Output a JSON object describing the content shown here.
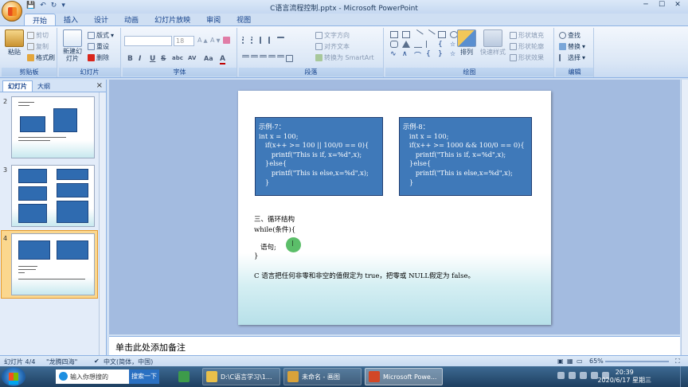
{
  "window": {
    "title": "C语言流程控制.pptx - Microsoft PowerPoint"
  },
  "ribbon": {
    "tabs": [
      "开始",
      "插入",
      "设计",
      "动画",
      "幻灯片放映",
      "审阅",
      "视图"
    ],
    "active_tab": "开始",
    "clipboard": {
      "label": "剪贴板",
      "paste": "粘贴",
      "cut": "剪切",
      "copy": "复制",
      "format_painter": "格式刷"
    },
    "slides": {
      "label": "幻灯片",
      "new_slide": "新建幻灯片",
      "layout": "版式",
      "reset": "重设",
      "delete": "删除"
    },
    "font": {
      "label": "字体",
      "font_size": "18",
      "buttons": [
        "B",
        "I",
        "U",
        "S",
        "abc",
        "AV",
        "Aa",
        "A"
      ]
    },
    "paragraph": {
      "label": "段落",
      "text_direction": "文字方向",
      "align_text": "对齐文本",
      "smartart": "转换为 SmartArt"
    },
    "drawing": {
      "label": "绘图",
      "arrange": "排列",
      "quick_styles": "快速样式",
      "shape_fill": "形状填充",
      "shape_outline": "形状轮廓",
      "shape_effects": "形状效果"
    },
    "editing": {
      "label": "编辑",
      "find": "查找",
      "replace": "替换",
      "select": "选择"
    }
  },
  "panel": {
    "tabs": [
      "幻灯片",
      "大纲"
    ],
    "active_tab": "幻灯片",
    "thumbnails": [
      {
        "num": "2"
      },
      {
        "num": "3"
      },
      {
        "num": "4",
        "selected": true
      }
    ]
  },
  "slide": {
    "box1": "示例-7：\nint x = 100;\n   if(x++ >= 100 || 100/0 == 0){\n      printf(\"This is if, x=%d\",x);\n   }else{\n      printf(\"This is else,x=%d\",x);\n   }",
    "box2": "示例-8：\n   int x = 100;\n   if(x++ >= 1000 && 100/0 == 0){\n      printf(\"This is if, x=%d\",x);\n   }else{\n      printf(\"This is else,x=%d\",x);\n   }",
    "section": "三、循环结构",
    "while_line": "while(条件){",
    "stmt": "语句;",
    "close": "}",
    "note": "C 语言把任何非零和非空的值假定为 true，把零或 NULL假定为 false。"
  },
  "notes": {
    "placeholder": "单击此处添加备注"
  },
  "statusbar": {
    "slide_info": "幻灯片 4/4",
    "theme": "\"龙腾四海\"",
    "language": "中文(简体，中国)",
    "zoom": "65%"
  },
  "taskbar": {
    "search_placeholder": "输入你想搜的",
    "search_button": "搜索一下",
    "apps": [
      {
        "label": "D:\\C语言学习\\1...",
        "color": "#e9c04a"
      },
      {
        "label": "未命名 - 画图",
        "color": "#d8a23a"
      },
      {
        "label": "Microsoft Powe...",
        "color": "#d24726"
      }
    ],
    "time": "20:39",
    "date": "2020/6/17 星期三"
  }
}
